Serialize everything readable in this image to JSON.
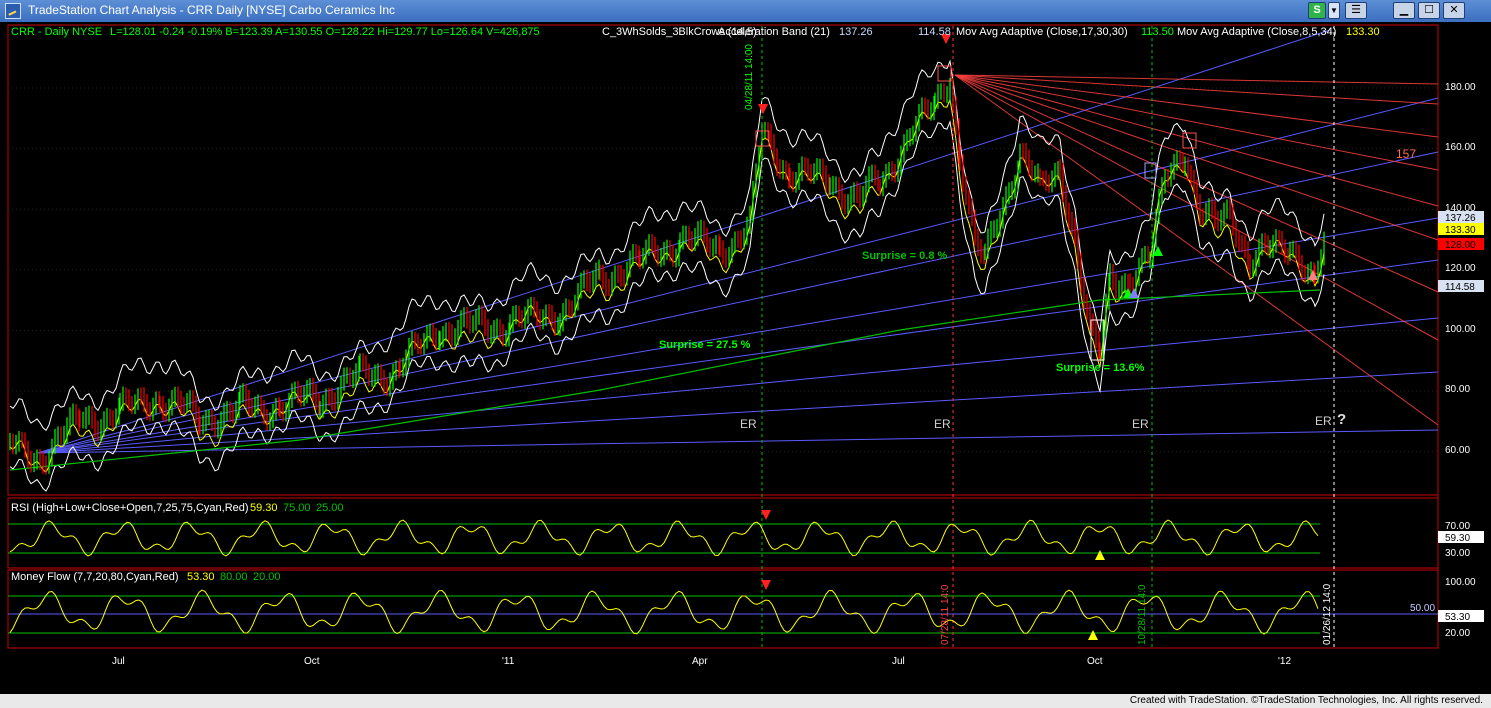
{
  "window": {
    "title": "TradeStation Chart Analysis - CRR Daily [NYSE] Carbo Ceramics Inc",
    "btn_s": "S",
    "btn_dd": "▼"
  },
  "header": {
    "symbol": "CRR - Daily  NYSE",
    "quote": "L=128.01  -0.24  -0.19%  B=123.39  A=130.55  O=128.22  Hi=129.77  Lo=126.64  V=426,875",
    "study1": "C_3WhSolds_3BlkCrows (14,5)",
    "study2": "Acceleration Band (21)",
    "study2_val": "137.26",
    "study3_val": "114.58",
    "study3": "Mov Avg Adaptive (Close,17,30,30)",
    "study4_val": "113.50",
    "study4": "Mov Avg Adaptive (Close,8,5,34)",
    "study4_val2": "133.30"
  },
  "price_axis": {
    "ticks": [
      "180.00",
      "160.00",
      "140.00",
      "120.00",
      "100.00",
      "80.00",
      "60.00"
    ],
    "tags": [
      {
        "label": "137.26",
        "bg": "#d8e2f2",
        "fg": "#000000"
      },
      {
        "label": "133.30",
        "bg": "#ffff00",
        "fg": "#000000"
      },
      {
        "label": "128.00",
        "bg": "#ff0000",
        "fg": "#000000"
      },
      {
        "label": "114.58",
        "bg": "#d8e2f2",
        "fg": "#000000"
      }
    ]
  },
  "annotations": {
    "surprise1": "Surprise = 27.5 %",
    "surprise2": "Surprise = 0.8 %",
    "surprise3": "Surprise = 13.6%",
    "er": "ER",
    "er_question": "?",
    "fan_label": "157",
    "date_label1": "04/28/11 14:00",
    "date_label2": "07/28/11 14:0",
    "date_label3": "10/28/11 14:0",
    "date_label4": "01/26/12 14:0"
  },
  "rsi": {
    "label": "RSI (High+Low+Close+Open,7,25,75,Cyan,Red)",
    "value": "59.30",
    "upper": "75.00",
    "lower": "25.00",
    "ticks": [
      "70.00",
      "30.00"
    ],
    "tag": "59.30"
  },
  "money_flow": {
    "label": "Money Flow (7,7,20,80,Cyan,Red)",
    "value": "53.30",
    "upper": "80.00",
    "lower": "20.00",
    "ticks": [
      "100.00",
      "20.00"
    ],
    "mid_label": "50.00",
    "tag": "53.30"
  },
  "time_axis": {
    "labels": [
      "Jul",
      "Oct",
      "'11",
      "Apr",
      "Jul",
      "Oct",
      "'12"
    ]
  },
  "footer": {
    "text": "Created with TradeStation. ©TradeStation Technologies, Inc. All rights reserved."
  },
  "colors": {
    "up_bar": "#00ff00",
    "down_bar": "#ff0000",
    "fan_blue": "#5a5aff",
    "fan_red": "#ff4040",
    "ma_green": "#00c000",
    "ma_yellow": "#ffff00",
    "band_white": "#ffffff",
    "surprise_text": "#00ff00"
  }
}
